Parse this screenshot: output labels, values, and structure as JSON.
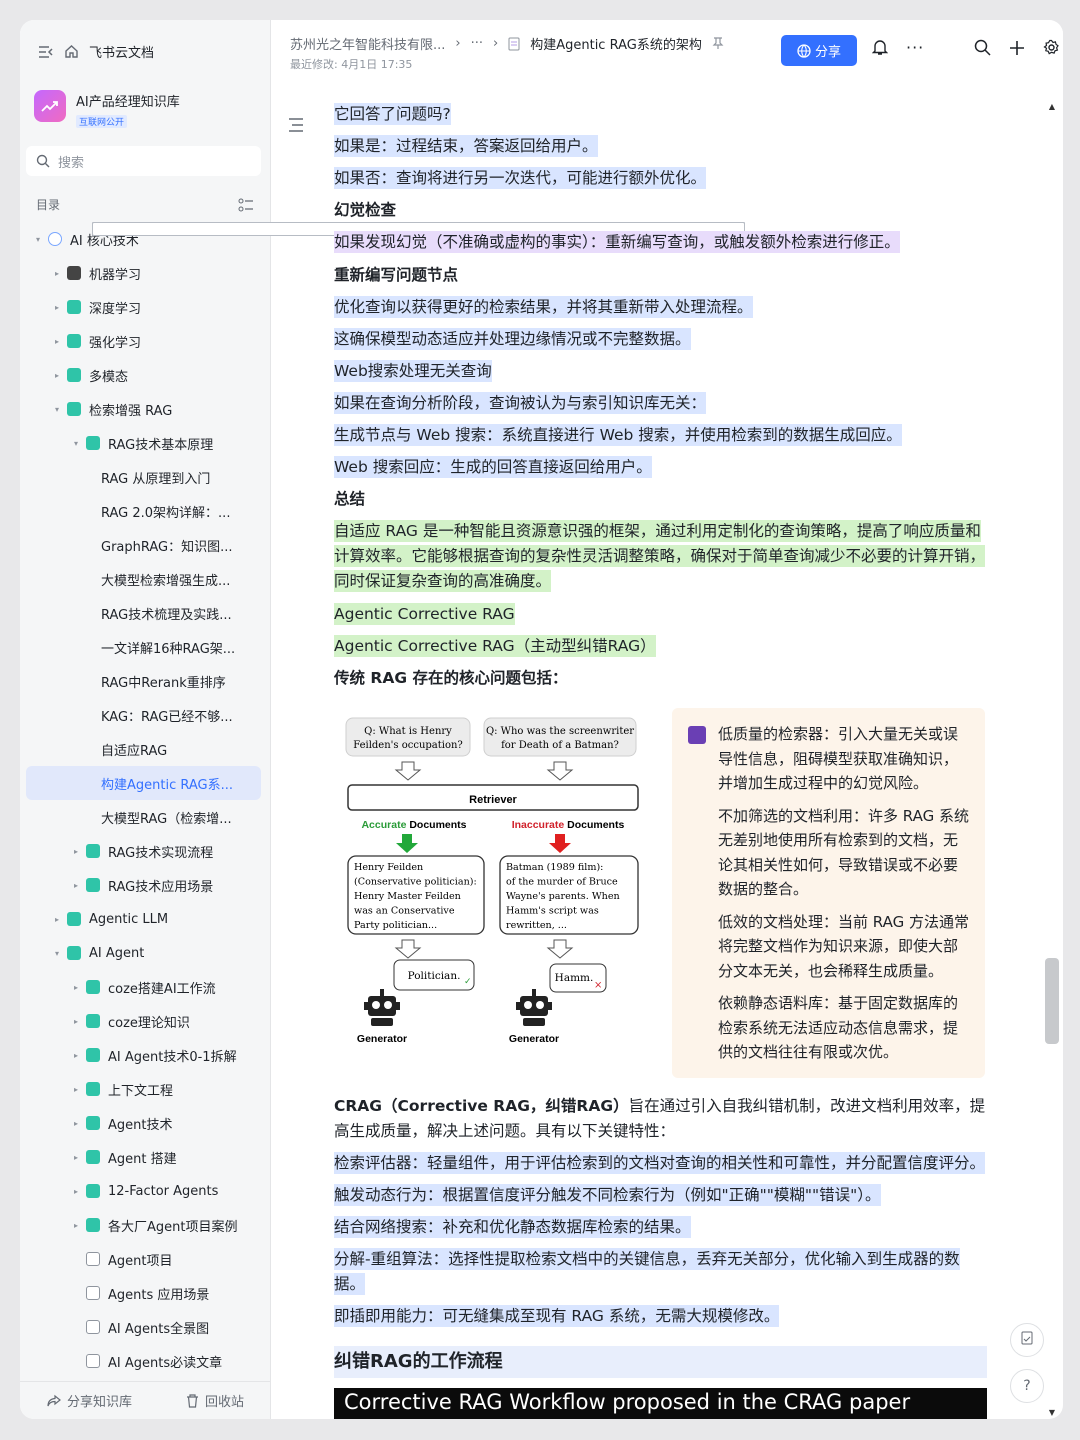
{
  "sidebar": {
    "app_name": "飞书云文档",
    "kb_name": "AI产品经理知识库",
    "kb_badge": "互联网公开",
    "search_placeholder": "搜索",
    "toc_label": "目录",
    "tree": [
      {
        "label": "AI 核心技术",
        "level": 0,
        "icon": "globe-icon",
        "arrow": "▾"
      },
      {
        "label": "机器学习",
        "level": 1,
        "icon": "robot-icon",
        "arrow": "▸"
      },
      {
        "label": "深度学习",
        "level": 1,
        "icon": "wiki-icon",
        "arrow": "▸"
      },
      {
        "label": "强化学习",
        "level": 1,
        "icon": "wiki-icon",
        "arrow": "▸"
      },
      {
        "label": "多模态",
        "level": 1,
        "icon": "wiki-icon",
        "arrow": "▸"
      },
      {
        "label": "检索增强 RAG",
        "level": 1,
        "icon": "wiki-icon",
        "arrow": "▾"
      },
      {
        "label": "RAG技术基本原理",
        "level": 2,
        "icon": "wiki-icon",
        "arrow": "▾"
      },
      {
        "label": "RAG 从原理到入门",
        "level": 3,
        "icon": "doc-icon",
        "arrow": ""
      },
      {
        "label": "RAG 2.0架构详解：...",
        "level": 3,
        "icon": "doc-icon",
        "arrow": ""
      },
      {
        "label": "GraphRAG：知识图...",
        "level": 3,
        "icon": "doc-icon",
        "arrow": ""
      },
      {
        "label": "大模型检索增强生成...",
        "level": 3,
        "icon": "doc-icon",
        "arrow": ""
      },
      {
        "label": "RAG技术梳理及实践...",
        "level": 3,
        "icon": "doc-icon",
        "arrow": ""
      },
      {
        "label": "一文详解16种RAG架...",
        "level": 3,
        "icon": "doc-icon",
        "arrow": ""
      },
      {
        "label": "RAG中Rerank重排序",
        "level": 3,
        "icon": "doc-icon",
        "arrow": ""
      },
      {
        "label": "KAG：RAG已经不够...",
        "level": 3,
        "icon": "doc-icon",
        "arrow": ""
      },
      {
        "label": "自适应RAG",
        "level": 3,
        "icon": "doc-icon",
        "arrow": ""
      },
      {
        "label": "构建Agentic RAG系...",
        "level": 3,
        "icon": "doc-icon",
        "arrow": "",
        "active": true
      },
      {
        "label": "大模型RAG（检索增...",
        "level": 3,
        "icon": "doc-icon",
        "arrow": ""
      },
      {
        "label": "RAG技术实现流程",
        "level": 2,
        "icon": "wiki-icon",
        "arrow": "▸"
      },
      {
        "label": "RAG技术应用场景",
        "level": 2,
        "icon": "wiki-icon",
        "arrow": "▸"
      },
      {
        "label": "Agentic LLM",
        "level": 1,
        "icon": "wiki-icon",
        "arrow": "▸"
      },
      {
        "label": "AI Agent",
        "level": 1,
        "icon": "wiki-icon",
        "arrow": "▾"
      },
      {
        "label": "coze搭建AI工作流",
        "level": 2,
        "icon": "wiki-icon",
        "arrow": "▸"
      },
      {
        "label": "coze理论知识",
        "level": 2,
        "icon": "wiki-icon",
        "arrow": "▸"
      },
      {
        "label": "AI Agent技术0-1拆解",
        "level": 2,
        "icon": "wiki-icon",
        "arrow": "▸"
      },
      {
        "label": "上下文工程",
        "level": 2,
        "icon": "wiki-icon",
        "arrow": "▸"
      },
      {
        "label": "Agent技术",
        "level": 2,
        "icon": "wiki-icon",
        "arrow": "▸"
      },
      {
        "label": "Agent 搭建",
        "level": 2,
        "icon": "wiki-icon",
        "arrow": "▸"
      },
      {
        "label": "12-Factor Agents",
        "level": 2,
        "icon": "wiki-icon",
        "arrow": "▸"
      },
      {
        "label": "各大厂Agent项目案例",
        "level": 2,
        "icon": "wiki-icon",
        "arrow": "▸"
      },
      {
        "label": "Agent项目",
        "level": 2,
        "icon": "box-icon",
        "arrow": ""
      },
      {
        "label": "Agents 应用场景",
        "level": 2,
        "icon": "box-icon",
        "arrow": ""
      },
      {
        "label": "AI Agents全景图",
        "level": 2,
        "icon": "box-icon",
        "arrow": ""
      },
      {
        "label": "AI Agents必读文章",
        "level": 2,
        "icon": "box-icon",
        "arrow": ""
      }
    ],
    "share_kb": "分享知识库",
    "recycle": "回收站"
  },
  "header": {
    "crumb_org": "苏州光之年智能科技有限...",
    "crumb_more": "···",
    "crumb_doc": "构建Agentic RAG系统的架构",
    "modified": "最近修改: 4月1日 17:35",
    "share": "分享"
  },
  "doc": {
    "lines": [
      {
        "text": "它回答了问题吗?",
        "style": "blue"
      },
      {
        "text": "如果是：过程结束，答案返回给用户。",
        "style": "blue"
      },
      {
        "text": "如果否：查询将进行另一次迭代，可能进行额外优化。",
        "style": "blue"
      },
      {
        "text": "幻觉检查",
        "style": "heading"
      },
      {
        "text": "如果发现幻觉（不准确或虚构的事实）：重新编写查询，或触发额外检索进行修正。",
        "style": "purple"
      },
      {
        "text": "重新编写问题节点",
        "style": "heading"
      },
      {
        "text": "优化查询以获得更好的检索结果，并将其重新带入处理流程。",
        "style": "blue"
      },
      {
        "text": "这确保模型动态适应并处理边缘情况或不完整数据。",
        "style": "blue"
      },
      {
        "text": "Web搜索处理无关查询",
        "style": "blue"
      },
      {
        "text": "如果在查询分析阶段，查询被认为与索引知识库无关：",
        "style": "blue"
      },
      {
        "text": "生成节点与 Web 搜索：系统直接进行 Web 搜索，并使用检索到的数据生成回应。",
        "style": "blue"
      },
      {
        "text": "Web 搜索回应：生成的回答直接返回给用户。",
        "style": "blue"
      },
      {
        "text": "总结",
        "style": "heading"
      }
    ],
    "summary": "自适应 RAG 是一种智能且资源意识强的框架，通过利用定制化的查询策略，提高了响应质量和计算效率。它能够根据查询的复杂性灵活调整策略，确保对于简单查询减少不必要的计算开销，同时保证复杂查询的高准确度。",
    "crag_title1": "Agentic Corrective RAG",
    "crag_title2": "Agentic Corrective RAG（主动型纠错RAG）",
    "core_problems": "传统 RAG 存在的核心问题包括：",
    "figure": {
      "q1_a": "Q: What is Henry",
      "q1_b": "Feilden's occupation?",
      "q2_a": "Q: Who was the screenwriter",
      "q2_b": "for Death of a Batman?",
      "retriever": "Retriever",
      "acc_1": "Accurate",
      "acc_2": " Documents",
      "inacc_1": "Inaccurate",
      "inacc_2": " Documents",
      "d1": [
        "Henry Feilden",
        "(Conservative politician):",
        "Henry Master Feilden",
        "was an Conservative",
        "Party politician..."
      ],
      "d2": [
        "Batman (1989 film):",
        "of the murder of Bruce",
        "Wayne's parents. When",
        "Hamm's script was",
        "rewritten, ..."
      ],
      "a1": "Politician.",
      "a2": "Hamm.",
      "gen": "Generator"
    },
    "callout": [
      "低质量的检索器：引入大量无关或误导性信息，阻碍模型获取准确知识，并增加生成过程中的幻觉风险。",
      "不加筛选的文档利用：许多 RAG 系统无差别地使用所有检索到的文档，无论其相关性如何，导致错误或不必要数据的整合。",
      "低效的文档处理：当前 RAG 方法通常将完整文档作为知识来源，即使大部分文本无关，也会稀释生成质量。",
      "依赖静态语料库：基于固定数据库的检索系统无法适应动态信息需求，提供的文档往往有限或次优。"
    ],
    "crag_bold": "CRAG（Corrective RAG，纠错RAG）",
    "crag_desc": "旨在通过引入自我纠错机制，改进文档利用效率，提高生成质量，解决上述问题。具有以下关键特性：",
    "features": [
      "检索评估器：轻量组件，用于评估检索到的文档对查询的相关性和可靠性，并分配置信度评分。",
      "触发动态行为：根据置信度评分触发不同检索行为（例如\"正确\"\"模糊\"\"错误\"）。",
      "结合网络搜索：补充和优化静态数据库检索的结果。",
      "分解-重组算法：选择性提取检索文档中的关键信息，丢弃无关部分，优化输入到生成器的数据。",
      "即插即用能力：可无缝集成至现有 RAG 系统，无需大规模修改。"
    ],
    "workflow_heading": "纠错RAG的工作流程",
    "image_caption": "Corrective RAG Workflow proposed in the CRAG paper"
  }
}
